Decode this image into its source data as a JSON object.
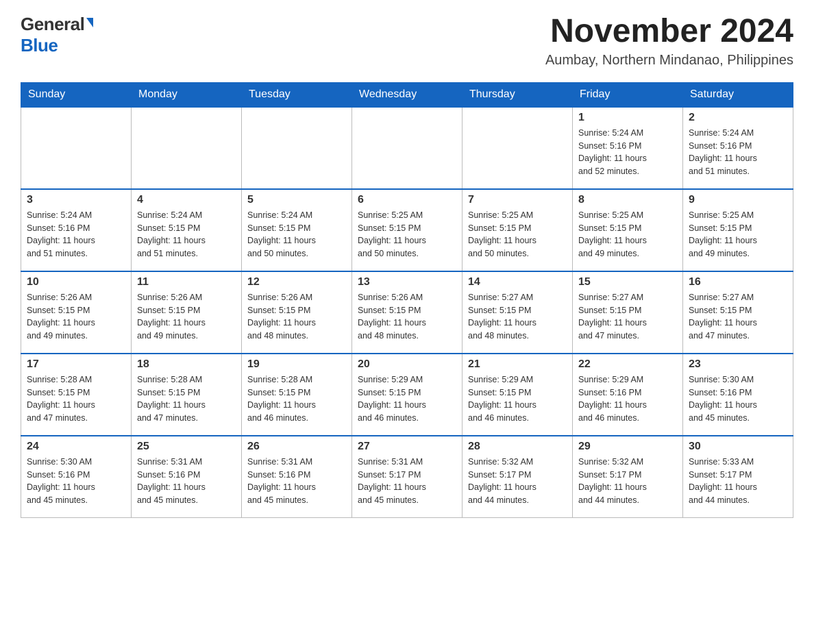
{
  "header": {
    "logo_general": "General",
    "logo_blue": "Blue",
    "month_title": "November 2024",
    "location": "Aumbay, Northern Mindanao, Philippines"
  },
  "days_of_week": [
    "Sunday",
    "Monday",
    "Tuesday",
    "Wednesday",
    "Thursday",
    "Friday",
    "Saturday"
  ],
  "weeks": [
    [
      {
        "day": "",
        "info": ""
      },
      {
        "day": "",
        "info": ""
      },
      {
        "day": "",
        "info": ""
      },
      {
        "day": "",
        "info": ""
      },
      {
        "day": "",
        "info": ""
      },
      {
        "day": "1",
        "info": "Sunrise: 5:24 AM\nSunset: 5:16 PM\nDaylight: 11 hours\nand 52 minutes."
      },
      {
        "day": "2",
        "info": "Sunrise: 5:24 AM\nSunset: 5:16 PM\nDaylight: 11 hours\nand 51 minutes."
      }
    ],
    [
      {
        "day": "3",
        "info": "Sunrise: 5:24 AM\nSunset: 5:16 PM\nDaylight: 11 hours\nand 51 minutes."
      },
      {
        "day": "4",
        "info": "Sunrise: 5:24 AM\nSunset: 5:15 PM\nDaylight: 11 hours\nand 51 minutes."
      },
      {
        "day": "5",
        "info": "Sunrise: 5:24 AM\nSunset: 5:15 PM\nDaylight: 11 hours\nand 50 minutes."
      },
      {
        "day": "6",
        "info": "Sunrise: 5:25 AM\nSunset: 5:15 PM\nDaylight: 11 hours\nand 50 minutes."
      },
      {
        "day": "7",
        "info": "Sunrise: 5:25 AM\nSunset: 5:15 PM\nDaylight: 11 hours\nand 50 minutes."
      },
      {
        "day": "8",
        "info": "Sunrise: 5:25 AM\nSunset: 5:15 PM\nDaylight: 11 hours\nand 49 minutes."
      },
      {
        "day": "9",
        "info": "Sunrise: 5:25 AM\nSunset: 5:15 PM\nDaylight: 11 hours\nand 49 minutes."
      }
    ],
    [
      {
        "day": "10",
        "info": "Sunrise: 5:26 AM\nSunset: 5:15 PM\nDaylight: 11 hours\nand 49 minutes."
      },
      {
        "day": "11",
        "info": "Sunrise: 5:26 AM\nSunset: 5:15 PM\nDaylight: 11 hours\nand 49 minutes."
      },
      {
        "day": "12",
        "info": "Sunrise: 5:26 AM\nSunset: 5:15 PM\nDaylight: 11 hours\nand 48 minutes."
      },
      {
        "day": "13",
        "info": "Sunrise: 5:26 AM\nSunset: 5:15 PM\nDaylight: 11 hours\nand 48 minutes."
      },
      {
        "day": "14",
        "info": "Sunrise: 5:27 AM\nSunset: 5:15 PM\nDaylight: 11 hours\nand 48 minutes."
      },
      {
        "day": "15",
        "info": "Sunrise: 5:27 AM\nSunset: 5:15 PM\nDaylight: 11 hours\nand 47 minutes."
      },
      {
        "day": "16",
        "info": "Sunrise: 5:27 AM\nSunset: 5:15 PM\nDaylight: 11 hours\nand 47 minutes."
      }
    ],
    [
      {
        "day": "17",
        "info": "Sunrise: 5:28 AM\nSunset: 5:15 PM\nDaylight: 11 hours\nand 47 minutes."
      },
      {
        "day": "18",
        "info": "Sunrise: 5:28 AM\nSunset: 5:15 PM\nDaylight: 11 hours\nand 47 minutes."
      },
      {
        "day": "19",
        "info": "Sunrise: 5:28 AM\nSunset: 5:15 PM\nDaylight: 11 hours\nand 46 minutes."
      },
      {
        "day": "20",
        "info": "Sunrise: 5:29 AM\nSunset: 5:15 PM\nDaylight: 11 hours\nand 46 minutes."
      },
      {
        "day": "21",
        "info": "Sunrise: 5:29 AM\nSunset: 5:15 PM\nDaylight: 11 hours\nand 46 minutes."
      },
      {
        "day": "22",
        "info": "Sunrise: 5:29 AM\nSunset: 5:16 PM\nDaylight: 11 hours\nand 46 minutes."
      },
      {
        "day": "23",
        "info": "Sunrise: 5:30 AM\nSunset: 5:16 PM\nDaylight: 11 hours\nand 45 minutes."
      }
    ],
    [
      {
        "day": "24",
        "info": "Sunrise: 5:30 AM\nSunset: 5:16 PM\nDaylight: 11 hours\nand 45 minutes."
      },
      {
        "day": "25",
        "info": "Sunrise: 5:31 AM\nSunset: 5:16 PM\nDaylight: 11 hours\nand 45 minutes."
      },
      {
        "day": "26",
        "info": "Sunrise: 5:31 AM\nSunset: 5:16 PM\nDaylight: 11 hours\nand 45 minutes."
      },
      {
        "day": "27",
        "info": "Sunrise: 5:31 AM\nSunset: 5:17 PM\nDaylight: 11 hours\nand 45 minutes."
      },
      {
        "day": "28",
        "info": "Sunrise: 5:32 AM\nSunset: 5:17 PM\nDaylight: 11 hours\nand 44 minutes."
      },
      {
        "day": "29",
        "info": "Sunrise: 5:32 AM\nSunset: 5:17 PM\nDaylight: 11 hours\nand 44 minutes."
      },
      {
        "day": "30",
        "info": "Sunrise: 5:33 AM\nSunset: 5:17 PM\nDaylight: 11 hours\nand 44 minutes."
      }
    ]
  ],
  "colors": {
    "header_bg": "#1565c0",
    "header_text": "#ffffff",
    "border": "#bbb",
    "text": "#333333",
    "logo_blue": "#1565c0"
  }
}
